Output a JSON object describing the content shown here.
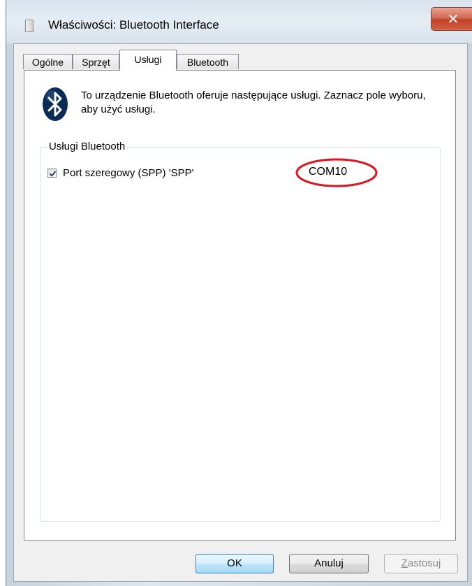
{
  "window": {
    "title": "Właściwości: Bluetooth Interface",
    "close_glyph": "✕"
  },
  "tabs": [
    {
      "label": "Ogólne",
      "active": false
    },
    {
      "label": "Sprzęt",
      "active": false
    },
    {
      "label": "Usługi",
      "active": true
    },
    {
      "label": "Bluetooth",
      "active": false
    }
  ],
  "panel": {
    "icon": "bluetooth-icon",
    "description": "To urządzenie Bluetooth oferuje następujące usługi. Zaznacz pole wyboru, aby użyć usługi.",
    "group_label": "Usługi Bluetooth",
    "services": [
      {
        "label": "Port szeregowy (SPP) 'SPP'",
        "checked": true,
        "port": "COM10"
      }
    ]
  },
  "buttons": {
    "ok": "OK",
    "cancel": "Anuluj",
    "apply_first": "Z",
    "apply_rest": "astosuj"
  },
  "colors": {
    "annotation": "#e0141e",
    "bluetooth_icon": "#0b2c55"
  }
}
